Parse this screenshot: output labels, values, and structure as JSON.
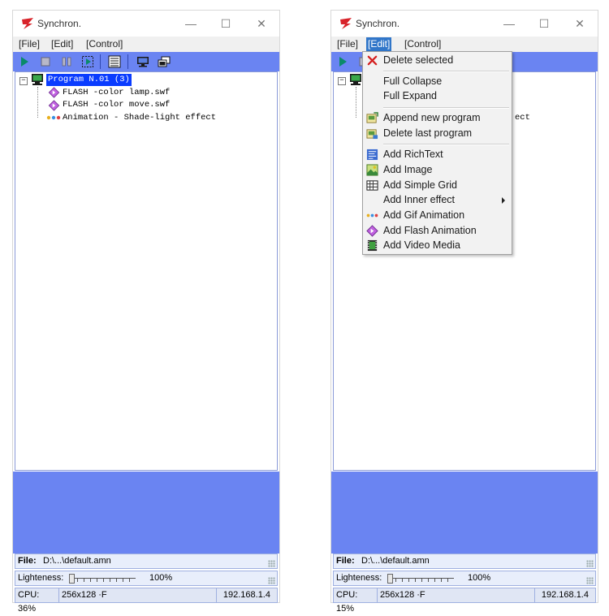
{
  "app": {
    "title": "Synchron."
  },
  "menu": {
    "file": "[File]",
    "edit": "[Edit]",
    "control": "[Control]"
  },
  "window_controls": {
    "minimize": "—",
    "maximize": "☐",
    "close": "✕"
  },
  "toolbar": {
    "icons": [
      "play-icon",
      "stop-icon",
      "pause-icon",
      "select-region-icon",
      "list-view-icon",
      "monitor-icon",
      "windows-icon"
    ]
  },
  "tree": {
    "program": "Program N.01 (3)",
    "items": [
      "FLASH -color lamp.swf",
      "FLASH -color move.swf",
      "Animation - Shade-light effect"
    ],
    "partial_text": "ect"
  },
  "status": {
    "file_label": "File:",
    "file_value": "D:\\...\\default.amn",
    "lightness_label": "Lighteness:",
    "lightness_value": "100%",
    "lightness_level": 0.0
  },
  "statusbar_left": {
    "cpu": "CPU: 36%",
    "resolution": "256x128 ·F",
    "ip": "192.168.1.4"
  },
  "statusbar_right": {
    "cpu": "CPU: 15%",
    "resolution": "256x128 ·F",
    "ip": "192.168.1.4"
  },
  "edit_menu": {
    "items": [
      {
        "label": "Delete selected",
        "icon": "delete-x-icon"
      },
      {
        "label": "Full Collapse",
        "icon": ""
      },
      {
        "label": "Full Expand",
        "icon": ""
      },
      {
        "label": "Append new program",
        "icon": "append-program-icon"
      },
      {
        "label": "Delete last program",
        "icon": "delete-program-icon"
      },
      {
        "label": "Add RichText",
        "icon": "richtext-icon"
      },
      {
        "label": "Add Image",
        "icon": "image-icon"
      },
      {
        "label": "Add Simple Grid",
        "icon": "grid-icon"
      },
      {
        "label": "Add Inner effect",
        "icon": ""
      },
      {
        "label": "Add Gif Animation",
        "icon": "gif-icon"
      },
      {
        "label": "Add Flash Animation",
        "icon": "flash-icon"
      },
      {
        "label": "Add Video Media",
        "icon": "video-icon"
      }
    ]
  },
  "colors": {
    "panel_blue": "#6a84f2",
    "selection_blue": "#0a3cff",
    "menu_highlight": "#3176c9"
  }
}
